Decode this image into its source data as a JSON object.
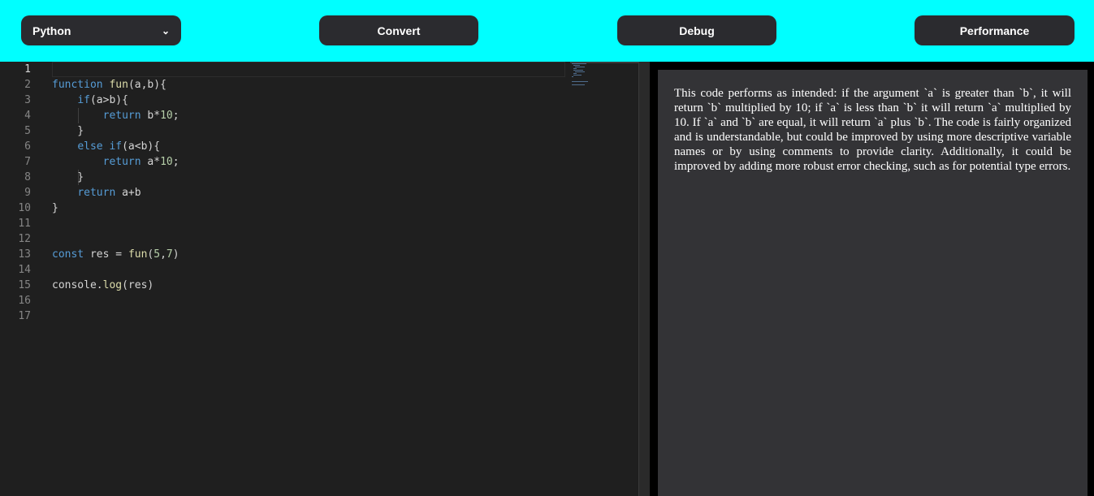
{
  "toolbar": {
    "language_select": {
      "selected": "Python"
    },
    "convert_label": "Convert",
    "debug_label": "Debug",
    "performance_label": "Performance"
  },
  "editor": {
    "active_line": 1,
    "line_numbers": [
      "1",
      "2",
      "3",
      "4",
      "5",
      "6",
      "7",
      "8",
      "9",
      "10",
      "11",
      "12",
      "13",
      "14",
      "15",
      "16",
      "17"
    ],
    "lines": [
      "",
      "function fun(a,b){",
      "    if(a>b){",
      "        return b*10;",
      "    }",
      "    else if(a<b){",
      "        return a*10;",
      "    }",
      "    return a+b",
      "}",
      "",
      "",
      "const res = fun(5,7)",
      "",
      "console.log(res)",
      "",
      ""
    ]
  },
  "output": {
    "text": "This code performs as intended: if the argument `a` is greater than `b`, it will return `b` multiplied by 10; if `a` is less than `b` it will return `a` multiplied by 10. If `a` and `b` are equal, it will return `a` plus `b`. The code is fairly organized and is understandable, but could be improved by using more descriptive variable names or by using comments to provide clarity. Additionally, it could be improved by adding more robust error checking, such as for potential type errors."
  },
  "colors": {
    "header_bg": "#00ffff",
    "button_bg": "#2b2b2f",
    "editor_bg": "#1f1f1f",
    "output_bg": "#333336",
    "keyword": "#569cd6",
    "function_name": "#dcdcaa",
    "number": "#b5cea8"
  }
}
